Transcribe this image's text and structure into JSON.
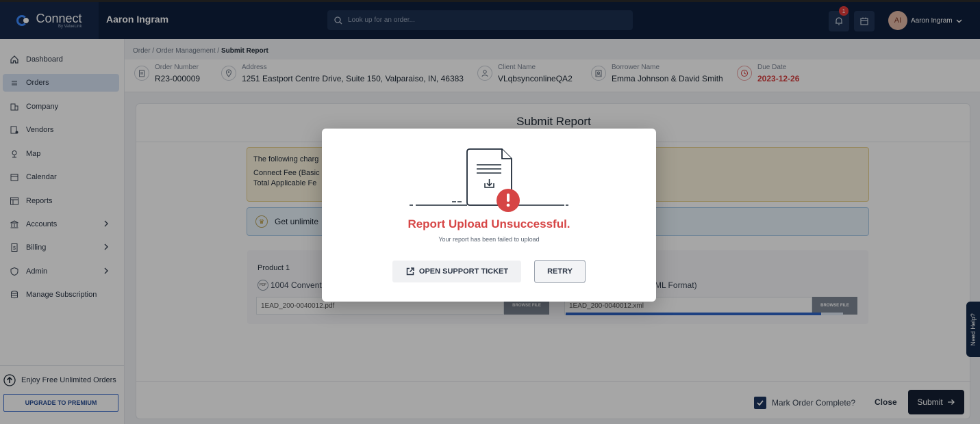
{
  "brand": {
    "name": "Connect",
    "sub": "By ValueLink"
  },
  "header": {
    "user_title": "Aaron Ingram",
    "search_placeholder": "Look up for an order...",
    "notification_count": "1",
    "avatar_initials": "AI",
    "user_name": "Aaron Ingram"
  },
  "sidebar": {
    "items": [
      {
        "label": "Dashboard",
        "icon": "home-icon"
      },
      {
        "label": "Orders",
        "icon": "list-icon",
        "active": true
      },
      {
        "label": "Company",
        "icon": "building-icon"
      },
      {
        "label": "Vendors",
        "icon": "vendor-icon"
      },
      {
        "label": "Map",
        "icon": "pin-icon"
      },
      {
        "label": "Calendar",
        "icon": "calendar-icon"
      },
      {
        "label": "Reports",
        "icon": "reports-icon"
      },
      {
        "label": "Accounts",
        "icon": "bank-icon",
        "expandable": true
      },
      {
        "label": "Billing",
        "icon": "billing-icon",
        "expandable": true
      },
      {
        "label": "Admin",
        "icon": "shield-icon",
        "expandable": true
      },
      {
        "label": "Manage Subscription",
        "icon": "database-icon"
      }
    ],
    "promo_text": "Enjoy Free Unlimited Orders",
    "upgrade_label": "UPGRADE TO PREMIUM"
  },
  "breadcrumb": {
    "path": "Order / Order Management / ",
    "current": "Submit Report"
  },
  "order_info": {
    "order_number": {
      "label": "Order Number",
      "value": "R23-000009"
    },
    "address": {
      "label": "Address",
      "value": "1251 Eastport Centre Drive, Suite 150, Valparaiso, IN, 46383"
    },
    "client_name": {
      "label": "Client Name",
      "value": "VLqbsynconlineQA2"
    },
    "borrower_name": {
      "label": "Borrower Name",
      "value": "Emma Johnson & David Smith"
    },
    "due_date": {
      "label": "Due Date",
      "value": "2023-12-26"
    }
  },
  "page": {
    "title": "Submit Report",
    "charges_intro": "The following charg",
    "fee_basic": "Connect Fee (Basic",
    "fee_total": "Total Applicable Fe",
    "unlimited_text": "Get unlimite",
    "product_title": "Product 1",
    "pdf_label": "1004 Convent",
    "xml_label": "ML Format)",
    "pdf_file": "1EAD_200-0040012.pdf",
    "xml_file": "1EAD_200-0040012.xml",
    "browse_label": "BROWSE FILE",
    "upload_progress_percent": 92,
    "mark_complete_label": "Mark Order Complete?",
    "close_label": "Close",
    "submit_label": "Submit"
  },
  "need_help": "Need Help?",
  "modal": {
    "title": "Report Upload Unsuccessful.",
    "subtitle": "Your report has been failed to upload",
    "support_label": "OPEN SUPPORT TICKET",
    "retry_label": "RETRY",
    "colors": {
      "error": "#d64545"
    }
  }
}
